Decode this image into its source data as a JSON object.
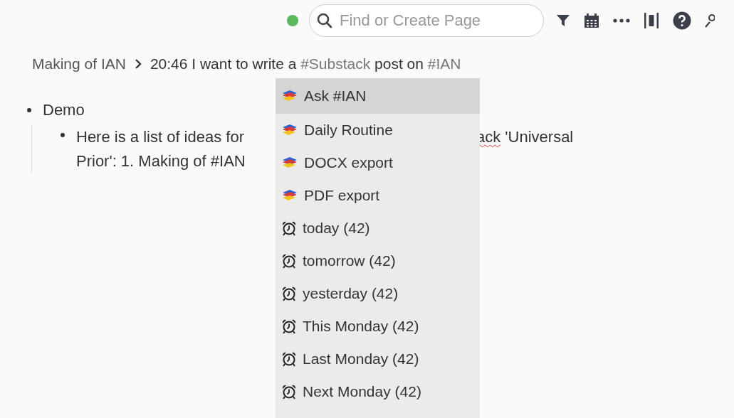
{
  "toolbar": {
    "status": {
      "color": "#5cb85c"
    },
    "search": {
      "placeholder": "Find or Create Page"
    }
  },
  "breadcrumb": {
    "parent": "Making of IAN",
    "title": [
      {
        "kind": "text",
        "text": "20:46 I want to write a "
      },
      {
        "kind": "tag",
        "text": "#Substack"
      },
      {
        "kind": "text",
        "text": " post on "
      },
      {
        "kind": "tag",
        "text": "#IAN"
      }
    ]
  },
  "outline": [
    {
      "text": "Demo",
      "children": [
        {
          "line_1_start": "Here is a list of ideas for",
          "line_1_end": "ack",
          "line_1_end_misspelled": true,
          "line_1_rest": " 'Universal",
          "line_2": "Prior': 1. Making of #IAN"
        }
      ]
    }
  ],
  "menu": [
    {
      "kind": "book",
      "label": "Ask #IAN",
      "selected": true
    },
    {
      "kind": "book",
      "label": "Daily Routine",
      "selected": false
    },
    {
      "kind": "book",
      "label": "DOCX export",
      "selected": false
    },
    {
      "kind": "book",
      "label": "PDF export",
      "selected": false
    },
    {
      "kind": "alarm",
      "label": "today (42)",
      "selected": false
    },
    {
      "kind": "alarm",
      "label": "tomorrow (42)",
      "selected": false
    },
    {
      "kind": "alarm",
      "label": "yesterday (42)",
      "selected": false
    },
    {
      "kind": "alarm",
      "label": "This Monday (42)",
      "selected": false
    },
    {
      "kind": "alarm",
      "label": "Last Monday (42)",
      "selected": false
    },
    {
      "kind": "alarm",
      "label": "Next Monday (42)",
      "selected": false
    }
  ]
}
